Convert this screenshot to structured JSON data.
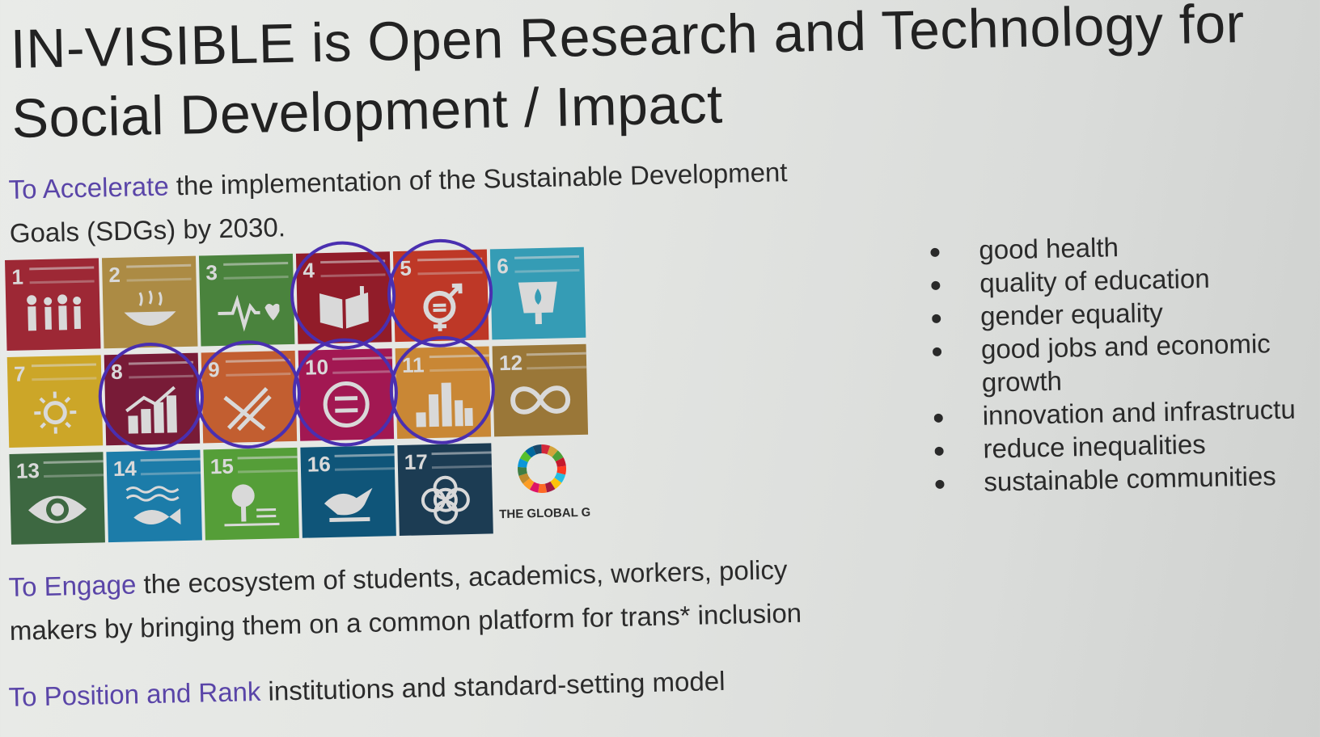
{
  "title": {
    "line1": "IN-VISIBLE is Open Research and Technology for",
    "line2": "Social Development / Impact"
  },
  "accelerate": {
    "highlight": "To Accelerate",
    "line1_rest": " the implementation of the Sustainable Development",
    "line2": "Goals (SDGs) by 2030."
  },
  "sdg_grid": {
    "tiles": [
      {
        "num": "1",
        "color": "#d3283a",
        "icon": "people-icon"
      },
      {
        "num": "2",
        "color": "#d3a33a",
        "icon": "bowl-icon"
      },
      {
        "num": "3",
        "color": "#4c9f38",
        "icon": "heartbeat-icon"
      },
      {
        "num": "4",
        "color": "#c5192d",
        "icon": "book-icon"
      },
      {
        "num": "5",
        "color": "#ff3a21",
        "icon": "gender-icon"
      },
      {
        "num": "6",
        "color": "#26bde2",
        "icon": "water-icon"
      },
      {
        "num": "7",
        "color": "#fcc30b",
        "icon": "sun-icon"
      },
      {
        "num": "8",
        "color": "#a21942",
        "icon": "growth-chart-icon"
      },
      {
        "num": "9",
        "color": "#fd6925",
        "icon": "infrastructure-icon"
      },
      {
        "num": "10",
        "color": "#dd1367",
        "icon": "equality-icon"
      },
      {
        "num": "11",
        "color": "#fd9d24",
        "icon": "city-icon"
      },
      {
        "num": "12",
        "color": "#bf8b2e",
        "icon": "infinity-icon"
      },
      {
        "num": "13",
        "color": "#3f7e44",
        "icon": "eye-globe-icon"
      },
      {
        "num": "14",
        "color": "#0a97d9",
        "icon": "fish-icon"
      },
      {
        "num": "15",
        "color": "#56c02b",
        "icon": "tree-icon"
      },
      {
        "num": "16",
        "color": "#00689d",
        "icon": "dove-icon"
      },
      {
        "num": "17",
        "color": "#19486a",
        "icon": "flower-icon"
      }
    ],
    "global_goals_label": "THE GLOBAL GOALS"
  },
  "bullets": [
    "good health",
    "quality of education",
    "gender equality",
    "good jobs and economic",
    "growth",
    "innovation and infrastructu",
    "reduce inequalities",
    "sustainable communities"
  ],
  "engage": {
    "highlight": "To Engage",
    "line1_rest": " the ecosystem of students, academics, workers, policy",
    "line2": "makers by bringing them on a common platform for trans* inclusion"
  },
  "position": {
    "highlight": "To Position and Rank",
    "rest": " institutions and standard-setting model"
  }
}
